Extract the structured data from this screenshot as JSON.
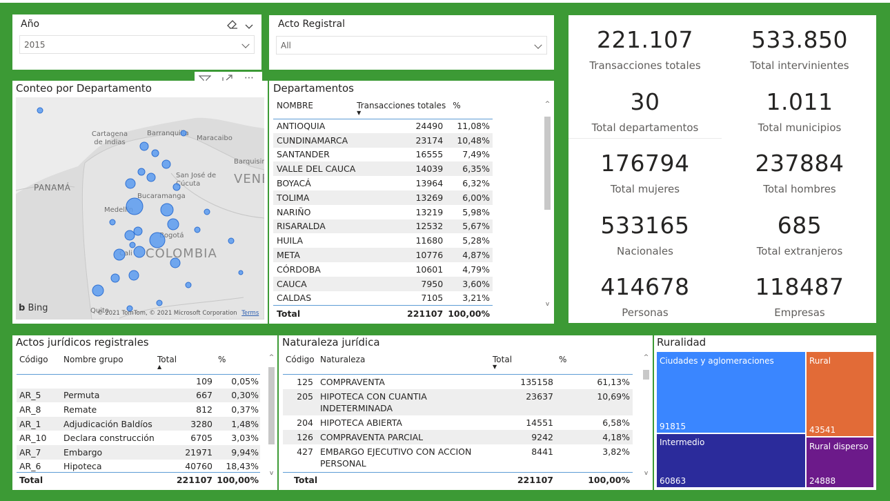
{
  "slicers": {
    "anio": {
      "label": "Año",
      "value": "2015"
    },
    "acto": {
      "label": "Acto Registral",
      "value": "All"
    }
  },
  "map": {
    "title": "Conteo por Departamento",
    "places": [
      "Cartagena de Indias",
      "Barranquilla",
      "Maracaibo",
      "Barquisimeto",
      "San José de Cúcuta",
      "Bucaramanga",
      "PANAMÁ",
      "VENE",
      "Medellín",
      "Bogotá",
      "COLOMBIA",
      "Cali",
      "Quito"
    ],
    "bing": "Bing",
    "copyright": "© 2021 TomTom, © 2021 Microsoft Corporation",
    "terms": "Terms"
  },
  "departamentos": {
    "title": "Departamentos",
    "headers": [
      "NOMBRE",
      "Transacciones totales",
      "%"
    ],
    "rows": [
      [
        "ANTIOQUIA",
        "24490",
        "11,08%"
      ],
      [
        "CUNDINAMARCA",
        "23174",
        "10,48%"
      ],
      [
        "SANTANDER",
        "16555",
        "7,49%"
      ],
      [
        "VALLE DEL CAUCA",
        "14039",
        "6,35%"
      ],
      [
        "BOYACÁ",
        "13964",
        "6,32%"
      ],
      [
        "TOLIMA",
        "13269",
        "6,00%"
      ],
      [
        "NARIÑO",
        "13219",
        "5,98%"
      ],
      [
        "RISARALDA",
        "12532",
        "5,67%"
      ],
      [
        "HUILA",
        "11680",
        "5,28%"
      ],
      [
        "META",
        "10776",
        "4,87%"
      ],
      [
        "CÓRDOBA",
        "10601",
        "4,79%"
      ],
      [
        "CAUCA",
        "7950",
        "3,60%"
      ],
      [
        "CALDAS",
        "7105",
        "3,21%"
      ]
    ],
    "total": [
      "Total",
      "221107",
      "100,00%"
    ]
  },
  "kpis": [
    {
      "value": "221.107",
      "label": "Transacciones totales"
    },
    {
      "value": "533.850",
      "label": "Total intervinientes"
    },
    {
      "value": "30",
      "label": "Total departamentos"
    },
    {
      "value": "1.011",
      "label": "Total municipios"
    },
    {
      "value": "176794",
      "label": "Total mujeres"
    },
    {
      "value": "237884",
      "label": "Total hombres"
    },
    {
      "value": "533165",
      "label": "Nacionales"
    },
    {
      "value": "685",
      "label": "Total extranjeros"
    },
    {
      "value": "414678",
      "label": "Personas"
    },
    {
      "value": "118487",
      "label": "Empresas"
    }
  ],
  "actos": {
    "title": "Actos jurídicos registrales",
    "headers": [
      "Código",
      "Nombre grupo",
      "Total",
      "%"
    ],
    "rows": [
      [
        "",
        "",
        "109",
        "0,05%"
      ],
      [
        "AR_5",
        "Permuta",
        "667",
        "0,30%"
      ],
      [
        "AR_8",
        "Remate",
        "812",
        "0,37%"
      ],
      [
        "AR_1",
        "Adjudicación Baldíos",
        "3280",
        "1,48%"
      ],
      [
        "AR_10",
        "Declara construcción",
        "6705",
        "3,03%"
      ],
      [
        "AR_7",
        "Embargo",
        "21971",
        "9,94%"
      ],
      [
        "AR_6",
        "Hipoteca",
        "40760",
        "18,43%"
      ]
    ],
    "total": [
      "Total",
      "",
      "221107",
      "100,00%"
    ]
  },
  "naturaleza": {
    "title": "Naturaleza jurídica",
    "headers": [
      "Código",
      "Naturaleza",
      "Total",
      "%"
    ],
    "rows": [
      [
        "125",
        "COMPRAVENTA",
        "135158",
        "61,13%"
      ],
      [
        "205",
        "HIPOTECA CON CUANTIA INDETERMINADA",
        "23637",
        "10,69%"
      ],
      [
        "204",
        "HIPOTECA ABIERTA",
        "14551",
        "6,58%"
      ],
      [
        "126",
        "COMPRAVENTA PARCIAL",
        "9242",
        "4,18%"
      ],
      [
        "427",
        "EMBARGO EJECUTIVO CON ACCION PERSONAL",
        "8441",
        "3,82%"
      ]
    ],
    "total": [
      "Total",
      "",
      "221107",
      "100,00%"
    ]
  },
  "ruralidad": {
    "title": "Ruralidad",
    "items": [
      {
        "name": "Ciudades y aglomeraciones",
        "value": "91815",
        "color": "#3a86ff"
      },
      {
        "name": "Intermedio",
        "value": "60863",
        "color": "#2b2b9b"
      },
      {
        "name": "Rural",
        "value": "43541",
        "color": "#e26b37"
      },
      {
        "name": "Rural disperso",
        "value": "24888",
        "color": "#6c1a8a"
      }
    ]
  }
}
